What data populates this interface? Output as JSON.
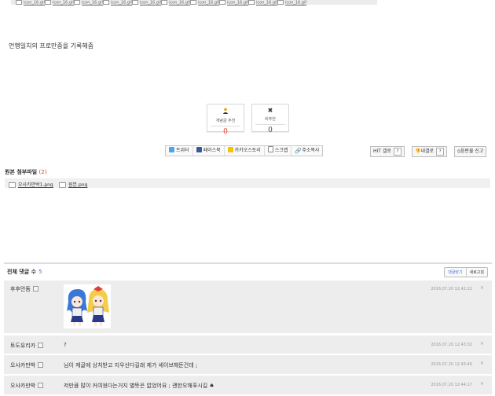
{
  "top_attachments": [
    "icon_16.gif",
    "icon_16.gif",
    "icon_16.gif",
    "icon_16.gif",
    "icon_16.gif",
    "icon_16.gif",
    "icon_16.gif",
    "icon_16.gif",
    "icon_16.gif",
    "icon_16.gif"
  ],
  "post": {
    "body": "언행일치의 프로만중을 기록해줌"
  },
  "votes": {
    "up": {
      "label": "개념글 추천",
      "count": "0"
    },
    "down": {
      "label": "비추천",
      "count": "0"
    }
  },
  "share": {
    "twitter": "트위터",
    "facebook": "페이스북",
    "kakao": "카카오스토리",
    "scrap": "스크랩",
    "copy_url": "주소복사"
  },
  "actions": {
    "hit": "HIT 갤로",
    "mygall": "내갤로",
    "report": "음란물 신고",
    "help": "?"
  },
  "attachments": {
    "title": "원본 첨부파일",
    "count": "(2)",
    "files": [
      "오사카만박1.png",
      "원본.png"
    ]
  },
  "comments": {
    "header": "전체 댓글 수",
    "count": "5",
    "btn_close": "댓글닫기",
    "btn_refresh": "새로고침",
    "items": [
      {
        "name": "후후안돔",
        "text": "",
        "date": "2016.07.20 12:42:22"
      },
      {
        "name": "토도유리카",
        "text": "?",
        "date": "2016.07.20 12:43:32"
      },
      {
        "name": "오사카만박",
        "text": "님이 제글에 상처받고 지우신다길래 제가 세이브해둔건데 ;",
        "date": "2016.07.20 12:43:40"
      },
      {
        "name": "오사카만박",
        "text": "저만큼 많이 커여웠다는거지 별뜻은 없었어요 ; 괜한오해푸시길 ♠",
        "date": "2016.07.20 12:44:17"
      }
    ]
  },
  "colors": {
    "accent": "#3a6fd8",
    "count_red": "#dd3333",
    "row_bg": "#ededed"
  }
}
